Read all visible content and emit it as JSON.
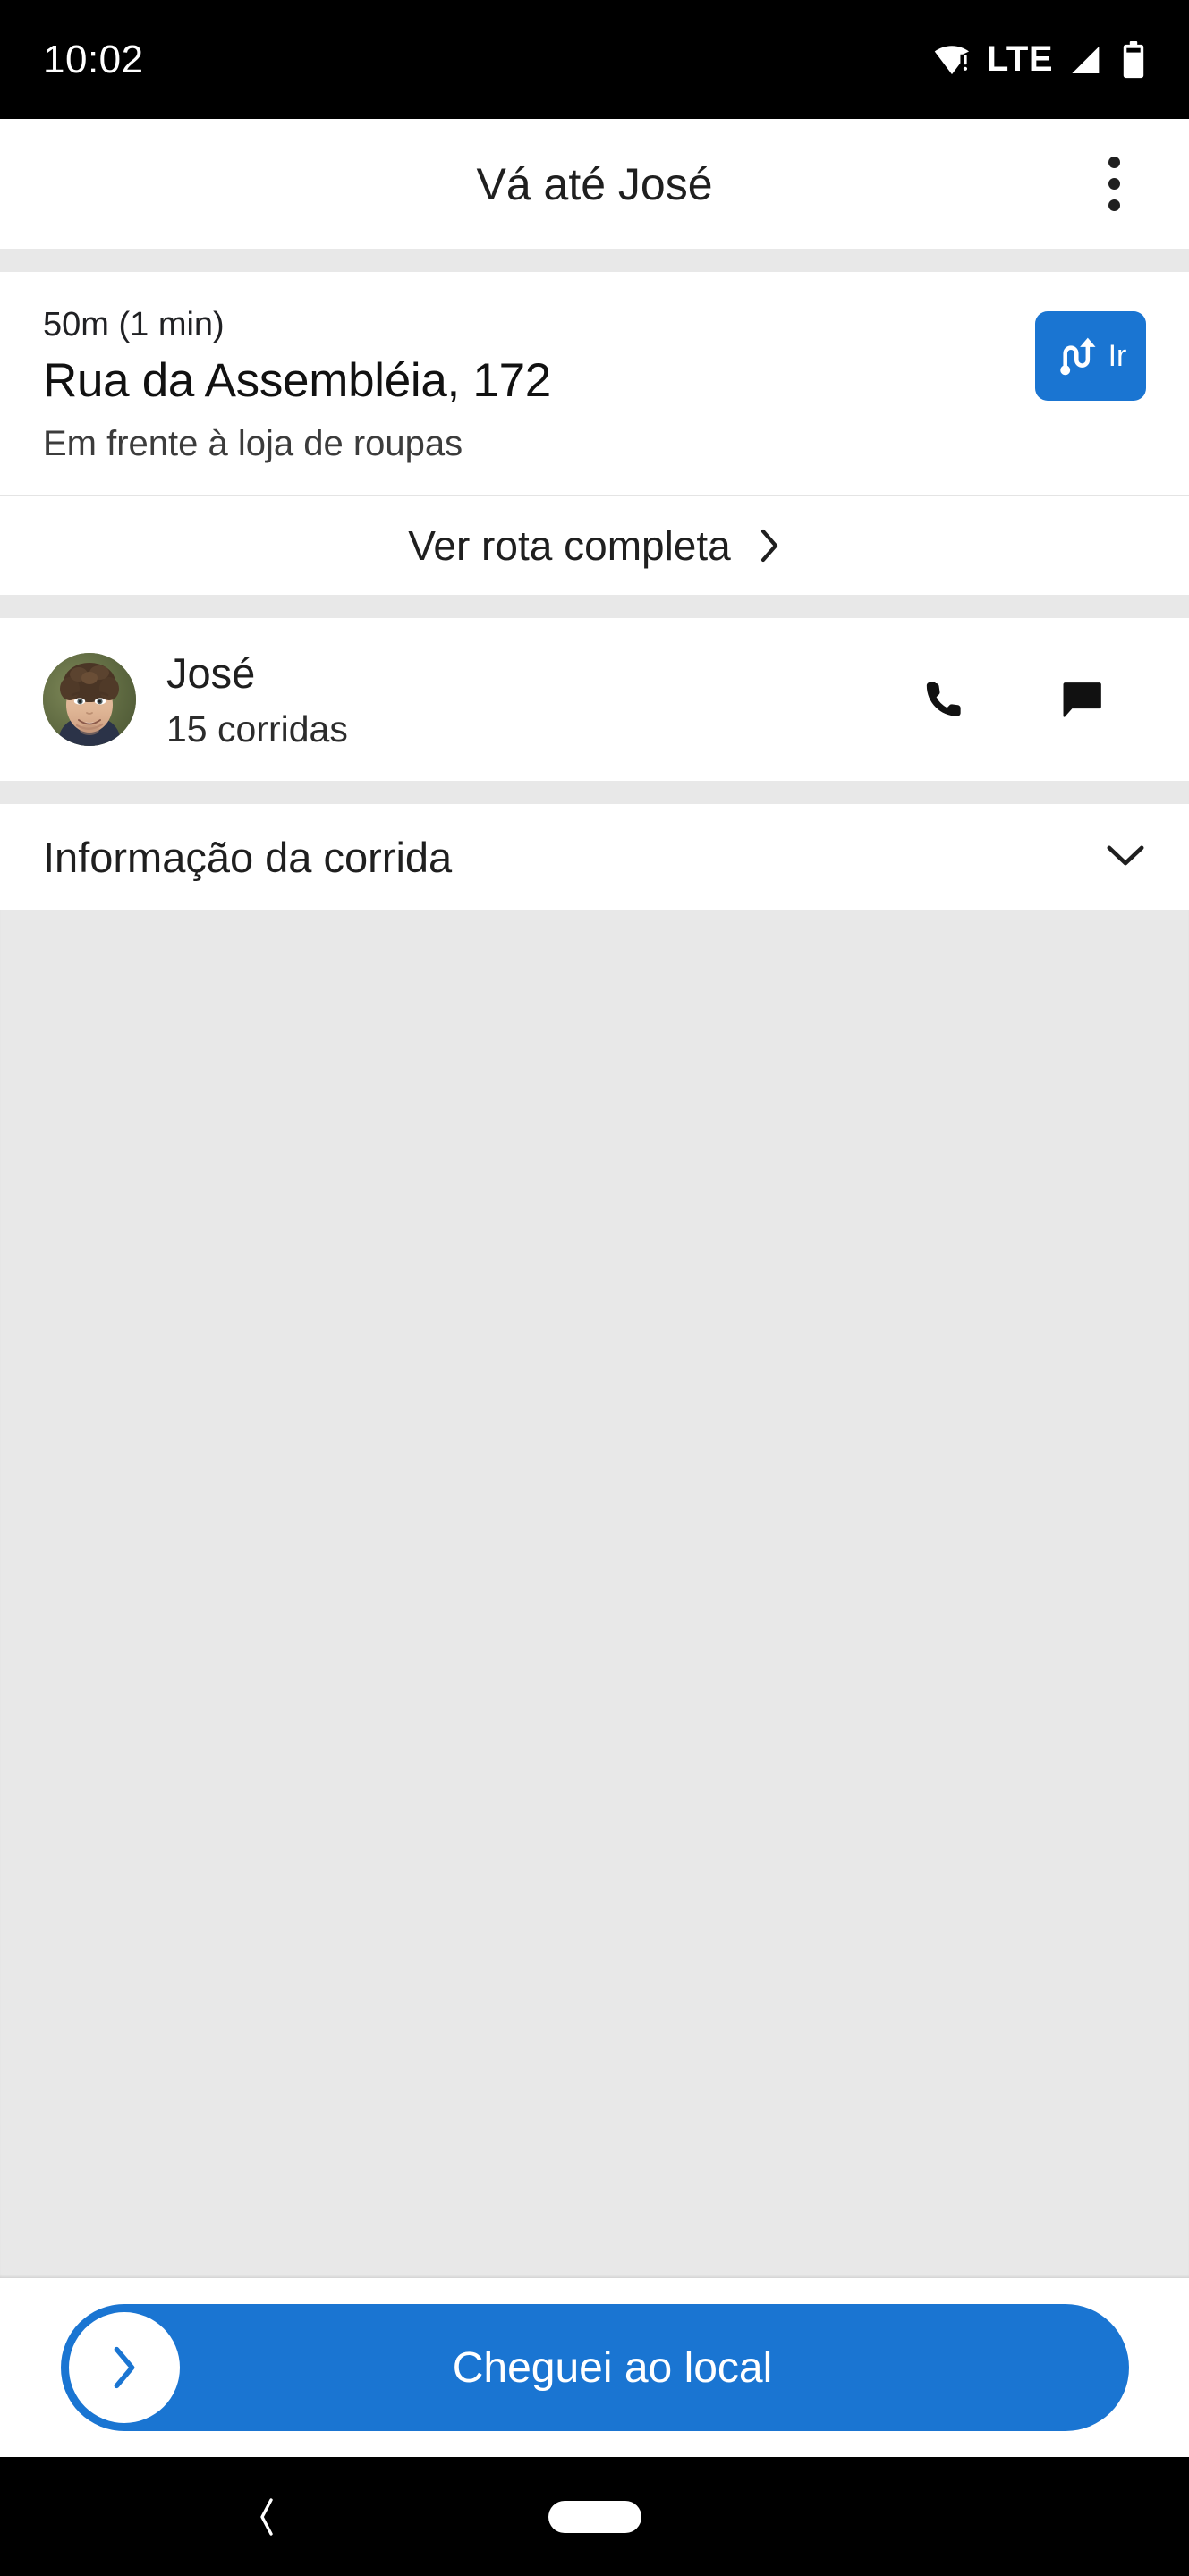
{
  "status_bar": {
    "time": "10:02",
    "network_label": "LTE",
    "wifi_icon": "wifi-warning-icon",
    "signal_icon": "signal-bars-icon",
    "battery_icon": "battery-icon"
  },
  "app_bar": {
    "title": "Vá até José",
    "overflow_icon": "more-vertical-icon"
  },
  "destination": {
    "eta": "50m (1 min)",
    "address": "Rua da Assembléia, 172",
    "note": "Em frente à loja de roupas",
    "go_button_label": "Ir",
    "go_button_icon": "route-icon",
    "go_button_color": "#1a75d2"
  },
  "full_route": {
    "label": "Ver rota completa",
    "chevron_icon": "chevron-right-icon"
  },
  "passenger": {
    "name": "José",
    "rides": "15 corridas",
    "avatar_icon": "avatar-photo",
    "call_icon": "phone-icon",
    "message_icon": "chat-bubble-icon"
  },
  "ride_info": {
    "label": "Informação da corrida",
    "chevron_icon": "chevron-down-icon"
  },
  "footer": {
    "cta_label": "Cheguei ao local",
    "cta_knob_icon": "chevron-right-icon",
    "cta_color": "#1a75d2"
  },
  "nav_bar": {
    "back_icon": "chevron-left-icon",
    "home_icon": "home-pill-icon"
  }
}
